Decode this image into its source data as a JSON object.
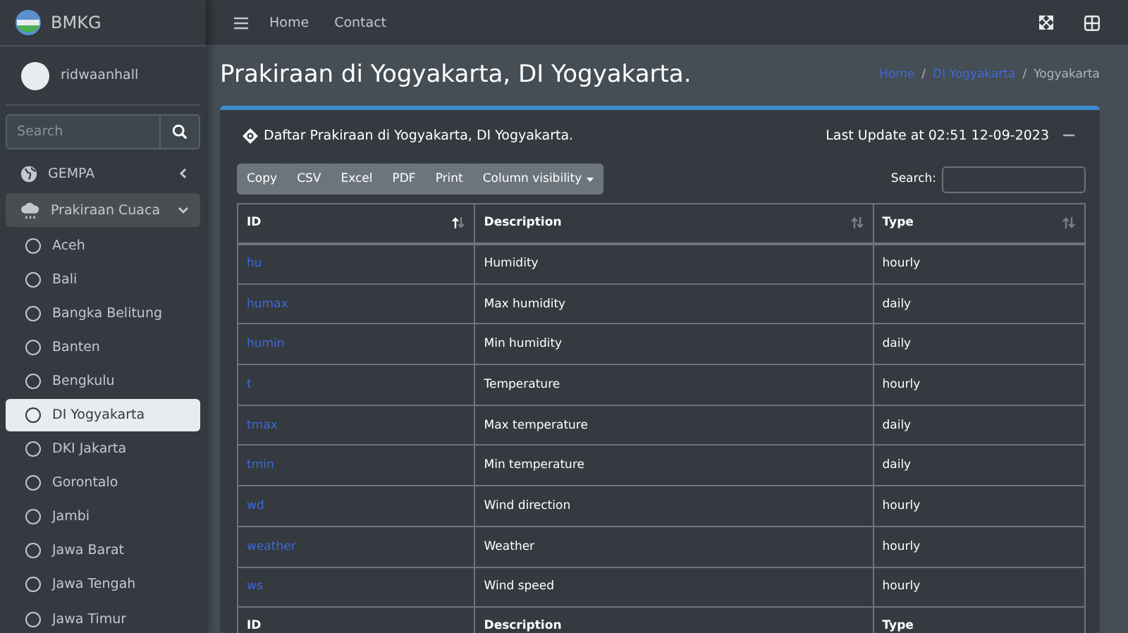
{
  "brand": {
    "name": "BMKG"
  },
  "topnav": {
    "links": [
      {
        "label": "Home"
      },
      {
        "label": "Contact"
      }
    ]
  },
  "user": {
    "name": "ridwaanhall"
  },
  "sidebar_search": {
    "placeholder": "Search"
  },
  "menu": [
    {
      "label": "GEMPA",
      "expanded": false,
      "kind": "globe"
    },
    {
      "label": "Prakiraan Cuaca",
      "expanded": true,
      "kind": "cloud",
      "children": [
        {
          "label": "Aceh",
          "selected": false
        },
        {
          "label": "Bali",
          "selected": false
        },
        {
          "label": "Bangka Belitung",
          "selected": false
        },
        {
          "label": "Banten",
          "selected": false
        },
        {
          "label": "Bengkulu",
          "selected": false
        },
        {
          "label": "DI Yogyakarta",
          "selected": true
        },
        {
          "label": "DKI Jakarta",
          "selected": false
        },
        {
          "label": "Gorontalo",
          "selected": false
        },
        {
          "label": "Jambi",
          "selected": false
        },
        {
          "label": "Jawa Barat",
          "selected": false
        },
        {
          "label": "Jawa Tengah",
          "selected": false
        },
        {
          "label": "Jawa Timur",
          "selected": false
        }
      ]
    }
  ],
  "page": {
    "title": "Prakiraan di Yogyakarta, DI Yogyakarta.",
    "breadcrumb": [
      {
        "label": "Home",
        "link": true
      },
      {
        "separator": "/",
        "label": "DI Yogyakarta",
        "link": true
      },
      {
        "separator": "/",
        "label": "Yogyakarta",
        "link": false
      }
    ]
  },
  "card": {
    "title": "Daftar Prakiraan di Yogyakarta, DI Yogyakarta.",
    "last_update": "Last Update at 02:51 12-09-2023"
  },
  "table_buttons": [
    "Copy",
    "CSV",
    "Excel",
    "PDF",
    "Print",
    "Column visibility"
  ],
  "table_search": {
    "label": "Search:"
  },
  "table": {
    "columns": [
      {
        "label": "ID",
        "sorted": true
      },
      {
        "label": "Description",
        "sorted": false
      },
      {
        "label": "Type",
        "sorted": false
      }
    ],
    "rows": [
      [
        "hu",
        "Humidity",
        "hourly"
      ],
      [
        "humax",
        "Max humidity",
        "daily"
      ],
      [
        "humin",
        "Min humidity",
        "daily"
      ],
      [
        "t",
        "Temperature",
        "hourly"
      ],
      [
        "tmax",
        "Max temperature",
        "daily"
      ],
      [
        "tmin",
        "Min temperature",
        "daily"
      ],
      [
        "wd",
        "Wind direction",
        "hourly"
      ],
      [
        "weather",
        "Weather",
        "hourly"
      ],
      [
        "ws",
        "Wind speed",
        "hourly"
      ]
    ],
    "footer": [
      "ID",
      "Description",
      "Type"
    ]
  }
}
